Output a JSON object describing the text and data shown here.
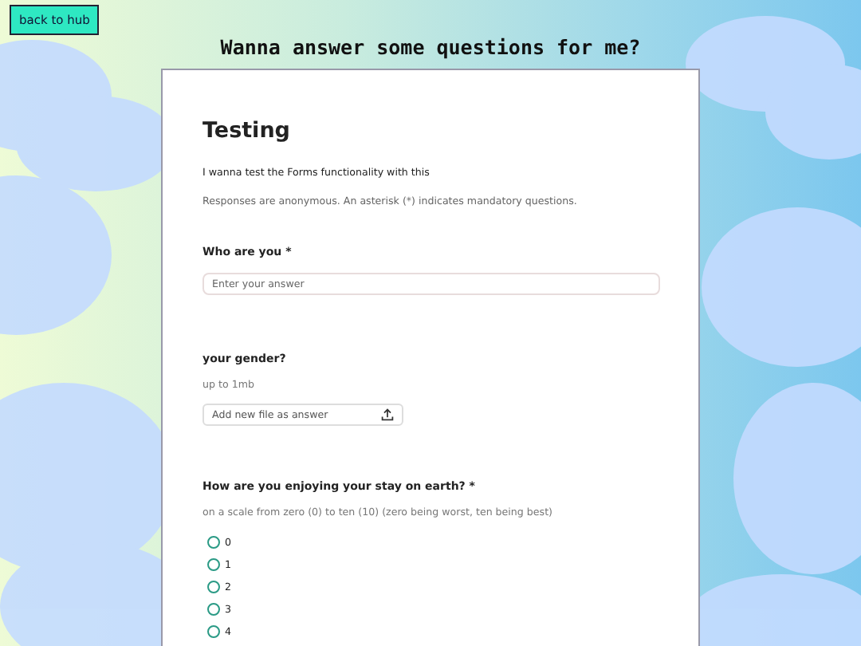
{
  "back_button": {
    "label": "back to hub"
  },
  "page_title": "Wanna answer some questions for me?",
  "form": {
    "title": "Testing",
    "description": "I wanna test the Forms functionality with this",
    "notice": "Responses are anonymous. An asterisk (*) indicates mandatory questions.",
    "questions": [
      {
        "kind": "text",
        "label": "Who are you *",
        "placeholder": "Enter your answer"
      },
      {
        "kind": "file",
        "label": "your gender?",
        "hint": "up to 1mb",
        "placeholder": "Add new file as answer"
      },
      {
        "kind": "radio",
        "label": "How are you enjoying your stay on earth? *",
        "hint": "on a scale from zero (0) to ten (10) (zero being worst, ten being best)",
        "options": [
          {
            "label": "0",
            "selected": false
          },
          {
            "label": "1",
            "selected": false
          },
          {
            "label": "2",
            "selected": false
          },
          {
            "label": "3",
            "selected": false
          },
          {
            "label": "4",
            "selected": false
          }
        ]
      }
    ]
  }
}
